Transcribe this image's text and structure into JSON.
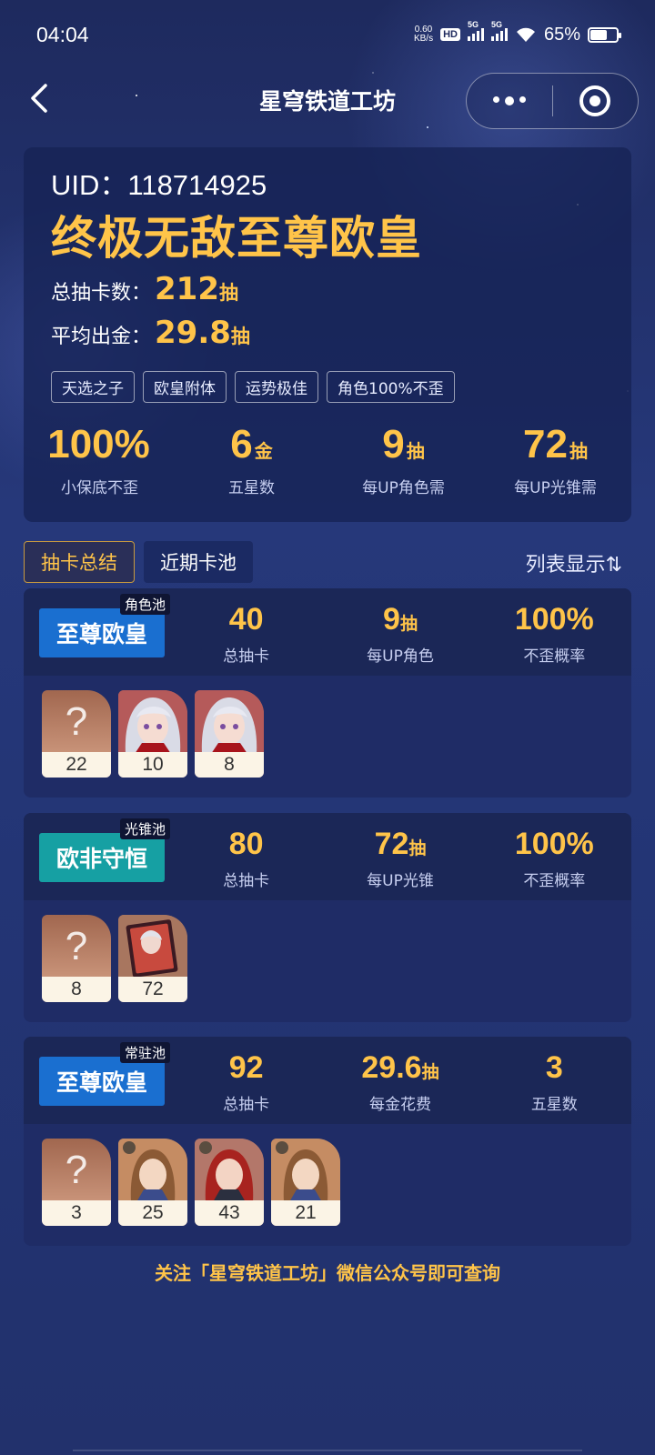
{
  "status_bar": {
    "time": "04:04",
    "net_speed_value": "0.60",
    "net_speed_unit": "KB/s",
    "hd_label": "HD",
    "signal1_label": "5G",
    "signal2_label": "5G",
    "battery_percent": "65%",
    "battery_level": 0.65
  },
  "nav": {
    "title": "星穹铁道工坊"
  },
  "profile": {
    "uid_label": "UID：",
    "uid_value": "118714925",
    "rank_title": "终极无敌至尊欧皇",
    "total_draws_label": "总抽卡数：",
    "total_draws_value": "212",
    "total_draws_unit": "抽",
    "avg_gold_label": "平均出金：",
    "avg_gold_value": "29.8",
    "avg_gold_unit": "抽",
    "tags": [
      "天选之子",
      "欧皇附体",
      "运势极佳",
      "角色100%不歪"
    ]
  },
  "summary": [
    {
      "value": "100%",
      "unit": "",
      "label": "小保底不歪"
    },
    {
      "value": "6",
      "unit": "金",
      "label": "五星数"
    },
    {
      "value": "9",
      "unit": "抽",
      "label": "每UP角色需"
    },
    {
      "value": "72",
      "unit": "抽",
      "label": "每UP光锥需"
    }
  ],
  "tabs": [
    {
      "label": "抽卡总结",
      "active": true
    },
    {
      "label": "近期卡池",
      "active": false
    }
  ],
  "list_toggle": "列表显示⇅",
  "pools": [
    {
      "type": "角色池",
      "badge": "至尊欧皇",
      "badge_color": "#1a6fd0",
      "stats": [
        {
          "value": "40",
          "unit": "",
          "label": "总抽卡"
        },
        {
          "value": "9",
          "unit": "抽",
          "label": "每UP角色"
        },
        {
          "value": "100%",
          "unit": "",
          "label": "不歪概率"
        }
      ],
      "draws": [
        {
          "kind": "unknown",
          "count": "22"
        },
        {
          "kind": "character-silver-hair",
          "count": "10"
        },
        {
          "kind": "character-silver-hair",
          "count": "8"
        }
      ]
    },
    {
      "type": "光锥池",
      "badge": "欧非守恒",
      "badge_color": "#16a0a3",
      "stats": [
        {
          "value": "80",
          "unit": "",
          "label": "总抽卡"
        },
        {
          "value": "72",
          "unit": "抽",
          "label": "每UP光锥"
        },
        {
          "value": "100%",
          "unit": "",
          "label": "不歪概率"
        }
      ],
      "draws": [
        {
          "kind": "unknown",
          "count": "8"
        },
        {
          "kind": "light-cone",
          "count": "72"
        }
      ]
    },
    {
      "type": "常驻池",
      "badge": "至尊欧皇",
      "badge_color": "#1a6fd0",
      "stats": [
        {
          "value": "92",
          "unit": "",
          "label": "总抽卡"
        },
        {
          "value": "29.6",
          "unit": "抽",
          "label": "每金花费"
        },
        {
          "value": "3",
          "unit": "",
          "label": "五星数"
        }
      ],
      "draws": [
        {
          "kind": "unknown",
          "count": "3"
        },
        {
          "kind": "character-brown-hair",
          "count": "25"
        },
        {
          "kind": "character-red-hair",
          "count": "43"
        },
        {
          "kind": "character-brown-hair",
          "count": "21"
        }
      ]
    }
  ],
  "footer_text": "关注「星穹铁道工坊」微信公众号即可查询"
}
